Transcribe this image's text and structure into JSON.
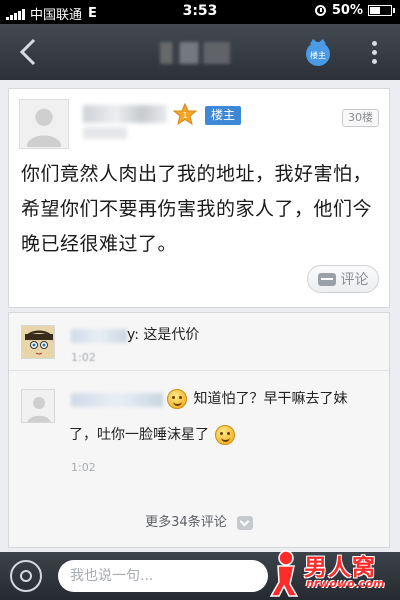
{
  "status_bar": {
    "carrier": "中国联通",
    "network": "E",
    "time": "3:53",
    "battery": "50%",
    "battery_level": 0.5
  },
  "nav_bar": {
    "back_icon": "chevron-left-icon",
    "owner_badge_text": "楼主",
    "more_icon": "vertical-dots-icon"
  },
  "post": {
    "level": "1",
    "owner_tag": "楼主",
    "floor": "30楼",
    "content": "你们竟然人肉出了我的地址，我好害怕，希望你们不要再伤害我的家人了，他们今晚已经很难过了。",
    "comment_button": "评论"
  },
  "replies": [
    {
      "text": "y: 这是代价",
      "time": "1:02"
    },
    {
      "text_line1": "知道怕了？早干嘛去了妹",
      "text_line2": "了，吐你一脸唾沫星了",
      "time": "1:02"
    }
  ],
  "more_comments": "更多34条评论",
  "input": {
    "placeholder": "我也说一句..."
  },
  "watermark": {
    "text": "男人窝",
    "url": "nrwowo.com"
  },
  "colors": {
    "navbar": "#2c3138",
    "owner_tag": "#3f88d8",
    "watermark": "#ff2b2b"
  }
}
